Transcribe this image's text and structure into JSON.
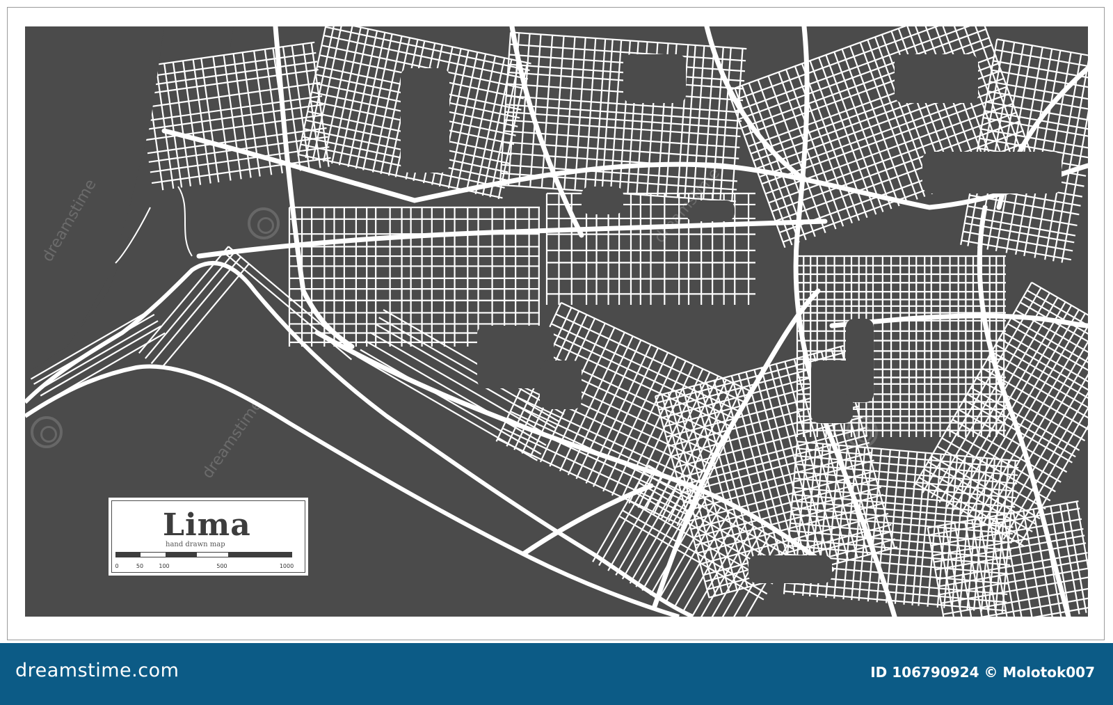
{
  "map": {
    "city": "Lima",
    "subtitle": "hand drawn map",
    "scale_labels": [
      "0",
      "50",
      "100",
      "500",
      "1000"
    ],
    "colors": {
      "land": "#4b4b4b",
      "streets": "#ffffff",
      "frame": "#9a9a9a"
    }
  },
  "watermark": {
    "text": "dreamstime"
  },
  "footer": {
    "brand": "dreamstime.com",
    "id_text": "ID 106790924 © Molotok007",
    "background": "#0c5b86"
  }
}
